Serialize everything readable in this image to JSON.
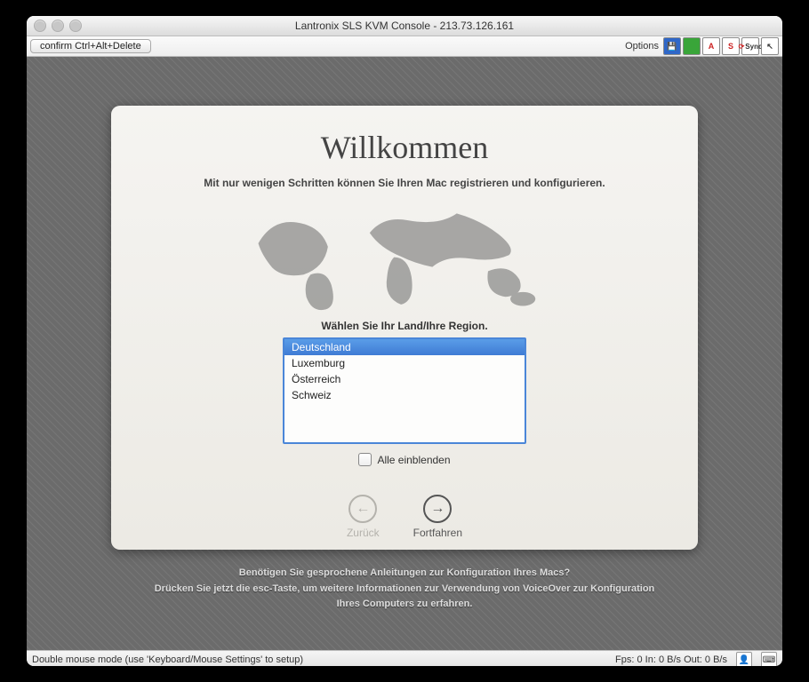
{
  "window": {
    "title": "Lantronix SLS KVM Console - 213.73.126.161"
  },
  "toolbar": {
    "confirm_btn": "confirm Ctrl+Alt+Delete",
    "options_label": "Options",
    "sync_label": "Sync"
  },
  "setup": {
    "heading": "Willkommen",
    "subtitle": "Mit nur wenigen Schritten können Sie Ihren Mac registrieren und konfigurieren.",
    "select_label": "Wählen Sie Ihr Land/Ihre Region.",
    "countries": [
      "Deutschland",
      "Luxemburg",
      "Österreich",
      "Schweiz"
    ],
    "selected_index": 0,
    "show_all_label": "Alle einblenden",
    "back_label": "Zurück",
    "continue_label": "Fortfahren"
  },
  "help": {
    "line1": "Benötigen Sie gesprochene Anleitungen zur Konfiguration Ihres Macs?",
    "line2": "Drücken Sie jetzt die esc-Taste, um weitere Informationen zur Verwendung von VoiceOver zur Konfiguration",
    "line3": "Ihres Computers zu erfahren."
  },
  "status": {
    "left": "Double mouse mode (use 'Keyboard/Mouse Settings' to setup)",
    "right": "Fps: 0 In: 0 B/s Out: 0 B/s"
  }
}
